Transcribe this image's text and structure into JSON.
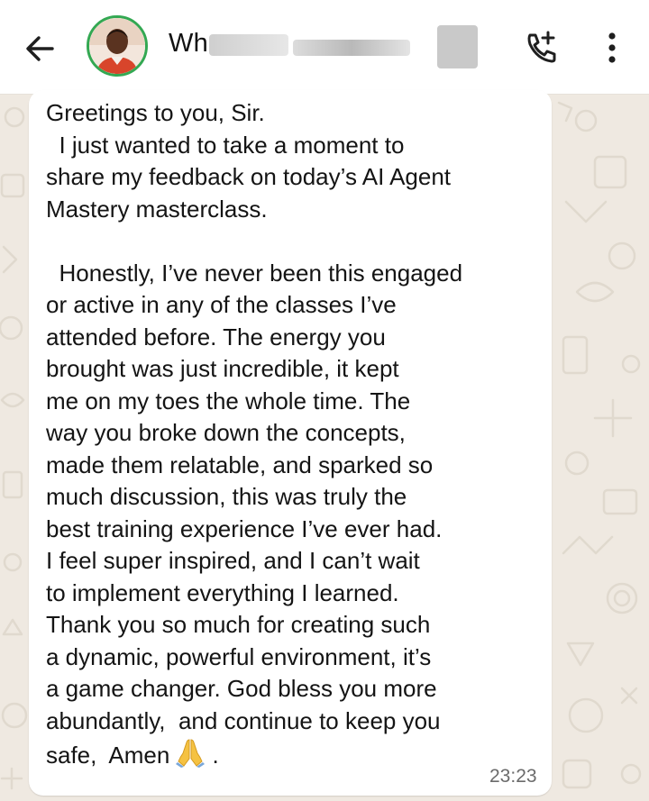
{
  "header": {
    "back_icon": "arrow-left-icon",
    "contact_name_visible": "Wh",
    "call_icon": "phone-add-icon",
    "menu_icon": "more-vertical-icon"
  },
  "message": {
    "body": "Greetings to you, Sir.\n  I just wanted to take a moment to\nshare my feedback on today’s AI Agent\nMastery masterclass.\n\n  Honestly, I’ve never been this engaged\nor active in any of the classes I’ve\nattended before. The energy you\nbrought was just incredible, it kept\nme on my toes the whole time. The\nway you broke down the concepts,\nmade them relatable, and sparked so\nmuch discussion, this was truly the\nbest training experience I’ve ever had.\nI feel super inspired, and I can’t wait\nto implement everything I learned.\nThank you so much for creating such\na dynamic, powerful environment, it’s\na game changer. God bless you more\nabundantly,  and continue to keep you",
    "last_line": "safe,  Amen",
    "emoji_icon": "folded-hands-icon",
    "trailing": ".",
    "time": "23:23"
  },
  "colors": {
    "wallpaper": "#efe9e1",
    "bubble": "#ffffff",
    "avatar_ring": "#33a852",
    "text": "#141414",
    "timestamp": "#6b6b6b"
  }
}
